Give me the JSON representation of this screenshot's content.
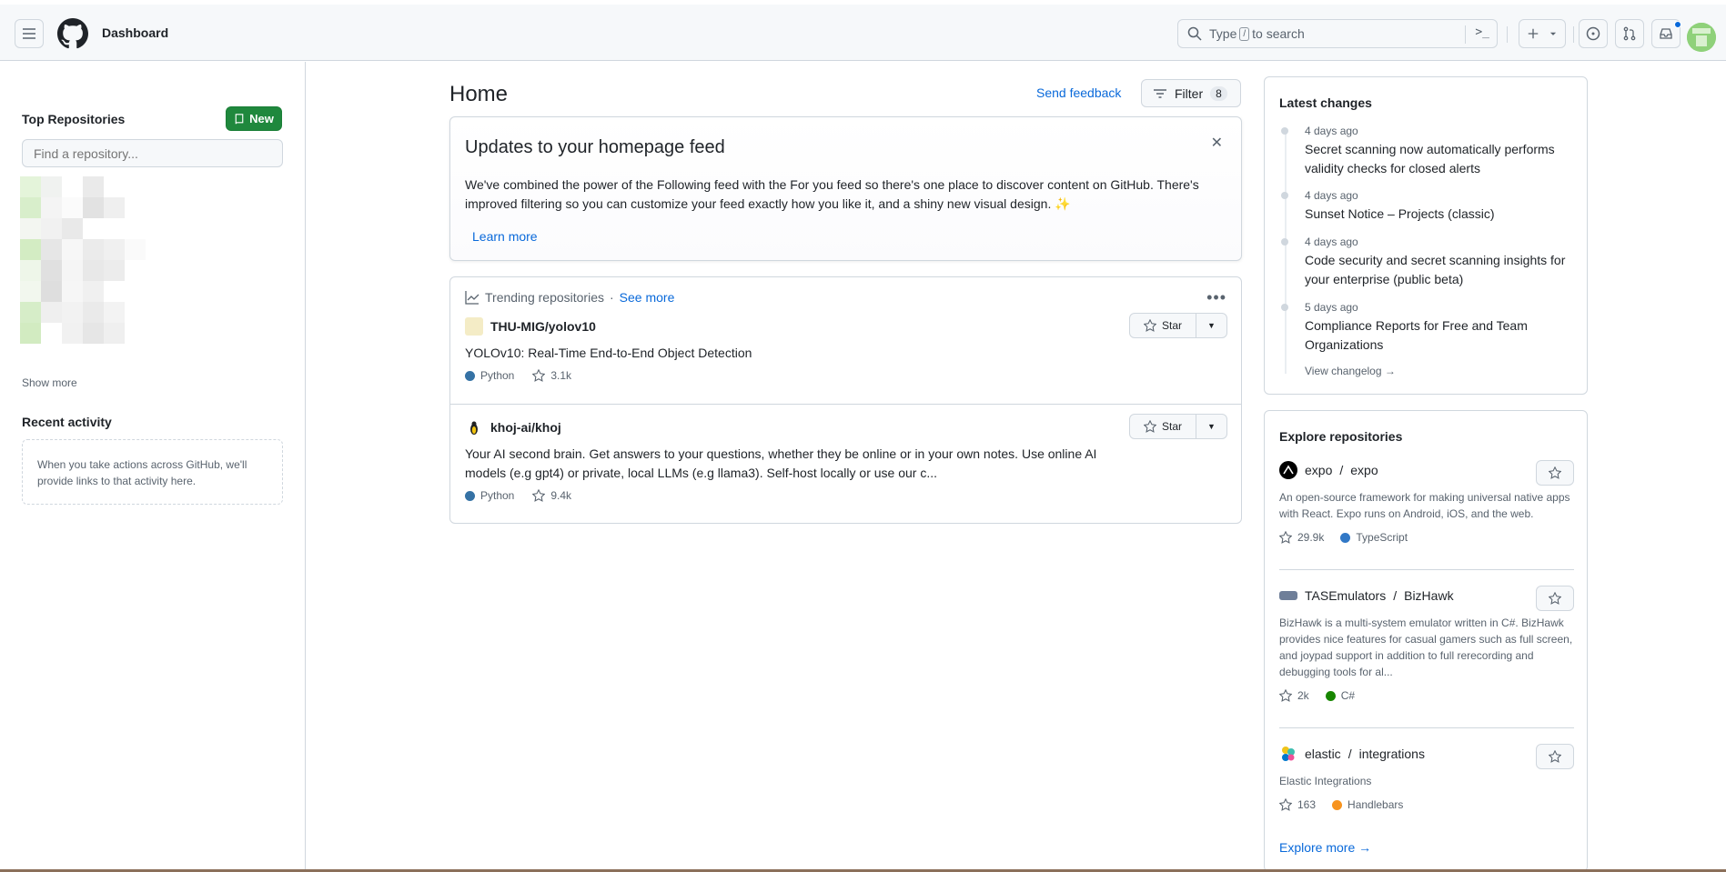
{
  "header": {
    "title": "Dashboard",
    "search_prefix": "Type",
    "search_key": "/",
    "search_suffix": "to search",
    "cmd_glyph": ">_"
  },
  "sidebar": {
    "top_repos_heading": "Top Repositories",
    "new_button": "New",
    "find_placeholder": "Find a repository...",
    "show_more": "Show more",
    "recent_heading": "Recent activity",
    "recent_empty": "When you take actions across GitHub, we'll provide links to that activity here."
  },
  "main": {
    "title": "Home",
    "send_feedback": "Send feedback",
    "filter_label": "Filter",
    "filter_count": "8",
    "updates": {
      "title": "Updates to your homepage feed",
      "body": "We've combined the power of the Following feed with the For you feed so there's one place to discover content on GitHub. There's improved filtering so you can customize your feed exactly how you like it, and a shiny new visual design. ✨",
      "learn_more": "Learn more"
    },
    "trending": {
      "heading": "Trending repositories",
      "separator": "·",
      "see_more": "See more",
      "repos": [
        {
          "name": "THU-MIG/yolov10",
          "description": "YOLOv10: Real-Time End-to-End Object Detection",
          "language": "Python",
          "language_color": "#3572A5",
          "stars": "3.1k",
          "star_label": "Star"
        },
        {
          "name": "khoj-ai/khoj",
          "description": "Your AI second brain. Get answers to your questions, whether they be online or in your own notes. Use online AI models (e.g gpt4) or private, local LLMs (e.g llama3). Self-host locally or use our c...",
          "language": "Python",
          "language_color": "#3572A5",
          "stars": "9.4k",
          "star_label": "Star"
        }
      ]
    }
  },
  "latest_changes": {
    "heading": "Latest changes",
    "items": [
      {
        "time": "4 days ago",
        "title": "Secret scanning now automatically performs validity checks for closed alerts"
      },
      {
        "time": "4 days ago",
        "title": "Sunset Notice – Projects (classic)"
      },
      {
        "time": "4 days ago",
        "title": "Code security and secret scanning insights for your enterprise (public beta)"
      },
      {
        "time": "5 days ago",
        "title": "Compliance Reports for Free and Team Organizations"
      }
    ],
    "view_changelog": "View changelog →"
  },
  "explore": {
    "heading": "Explore repositories",
    "repos": [
      {
        "owner": "expo",
        "name": "expo",
        "description": "An open-source framework for making universal native apps with React. Expo runs on Android, iOS, and the web.",
        "stars": "29.9k",
        "language": "TypeScript",
        "language_color": "#3178c6"
      },
      {
        "owner": "TASEmulators",
        "name": "BizHawk",
        "description": "BizHawk is a multi-system emulator written in C#. BizHawk provides nice features for casual gamers such as full screen, and joypad support in addition to full rerecording and debugging tools for al...",
        "stars": "2k",
        "language": "C#",
        "language_color": "#178600"
      },
      {
        "owner": "elastic",
        "name": "integrations",
        "description": "Elastic Integrations",
        "stars": "163",
        "language": "Handlebars",
        "language_color": "#f7931e"
      }
    ],
    "slash": "/",
    "explore_more": "Explore more →"
  },
  "colors": {
    "accent": "#0969da",
    "primary_button": "#1f883d",
    "border": "#d0d7de"
  }
}
